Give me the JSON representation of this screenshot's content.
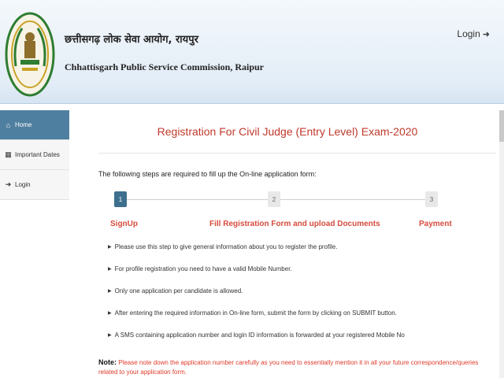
{
  "header": {
    "org_name_hindi": "छत्तीसगढ़ लोक सेवा आयोग, रायपुर",
    "org_name_english": "Chhattisgarh Public Service Commission, Raipur",
    "login_label": "Login",
    "logo_icon": "cgpsc-emblem-icon",
    "colors": {
      "band": "#e3edf7",
      "logo_green": "#2e7d32",
      "logo_gold": "#c9a227"
    }
  },
  "sidebar": {
    "items": [
      {
        "label": "Home",
        "icon": "home-icon",
        "active": true
      },
      {
        "label": "Important Dates",
        "icon": "calendar-icon",
        "active": false
      },
      {
        "label": "Login",
        "icon": "login-icon",
        "active": false
      }
    ],
    "active_color": "#4f7fa0"
  },
  "main": {
    "title": "Registration For Civil Judge (Entry Level) Exam-2020",
    "intro": "The following steps are required to fill up the On-line application form:",
    "steps": [
      {
        "number": "1",
        "label": "SignUp",
        "active": true
      },
      {
        "number": "2",
        "label": "Fill Registration Form and upload Documents",
        "active": false
      },
      {
        "number": "3",
        "label": "Payment",
        "active": false
      }
    ],
    "bullets": [
      "Please use this step to give general information about you to register the profile.",
      "For profile registration you need to have a valid Mobile Number.",
      "Only one application per candidate is allowed.",
      "After entering the required information in On-line form, submit the form by clicking on SUBMIT button.",
      "A SMS containing application number and login ID information is forwarded at your registered Mobile No"
    ],
    "note_label": "Note:",
    "note_text": "Please note down the application number carefully as you need to essentially mention it in all your future correspondence/queries related to your application form.",
    "colors": {
      "title": "#c0392b",
      "step_label": "#d64b3d",
      "step_active": "#3e6f8e",
      "note": "#e03b2b"
    }
  }
}
